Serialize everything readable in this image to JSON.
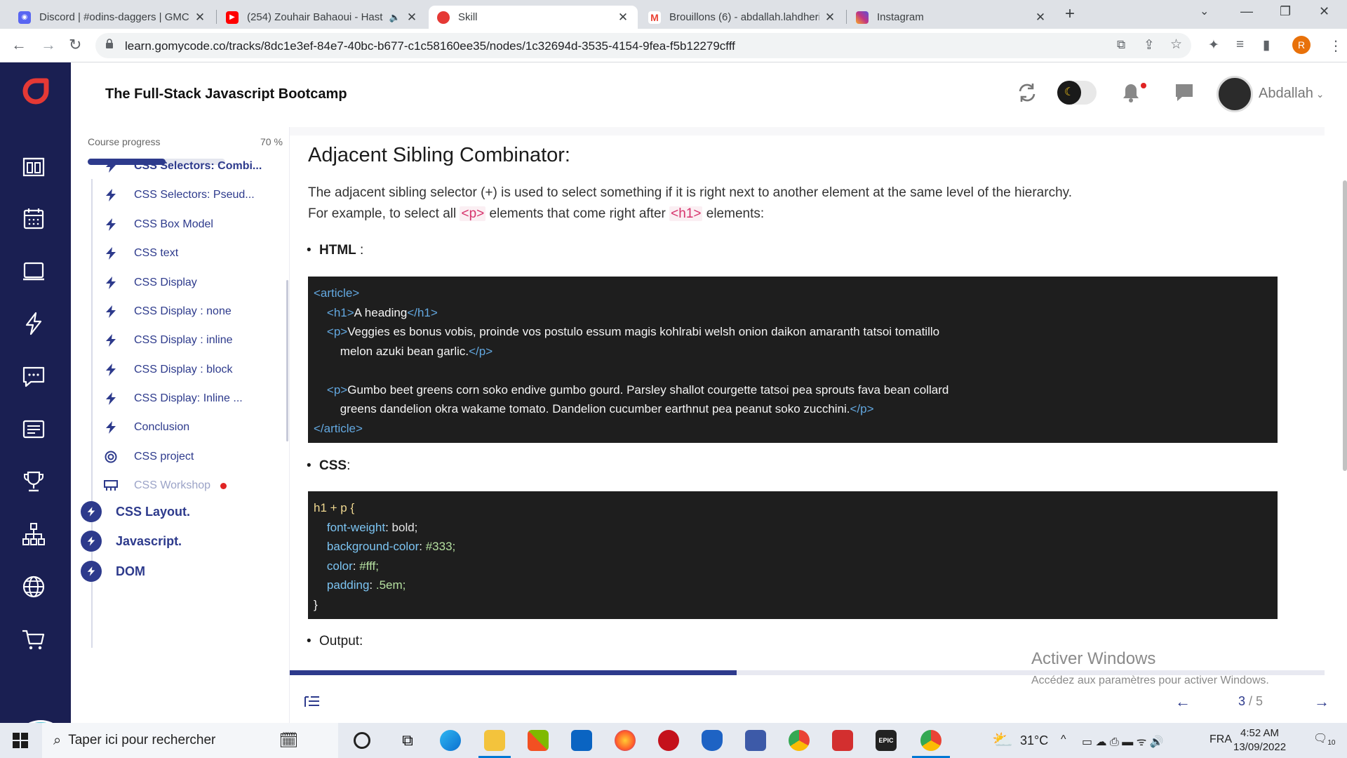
{
  "browser": {
    "tabs": [
      {
        "title": "Discord | #odins-daggers | GMC",
        "icon": "discord-icon",
        "color": "#5865f2"
      },
      {
        "title": "(254) Zouhair Bahaoui - Hast",
        "icon": "youtube-icon",
        "color": "#ff0000"
      },
      {
        "title": "Skill",
        "icon": "gomycode-icon",
        "color": "#e53935"
      },
      {
        "title": "Brouillons (6) - abdallah.lahdheri",
        "icon": "gmail-icon",
        "color": "#ea4335"
      },
      {
        "title": "Instagram",
        "icon": "instagram-icon",
        "color": "#c13584"
      }
    ],
    "url": "learn.gomycode.co/tracks/8dc1e3ef-84e7-40bc-b677-c1c58160ee35/nodes/1c32694d-3535-4154-9fea-f5b12279cfff",
    "profile_initial": "R"
  },
  "header": {
    "course_title": "The Full-Stack Javascript Bootcamp",
    "user_name": "Abdallah"
  },
  "sidebar": {
    "progress_label": "Course progress",
    "progress_value": "70 %",
    "progress_fraction": 0.7,
    "items": [
      {
        "label": "CSS Selectors: Combi...",
        "icon": "bolt-icon",
        "state": "active"
      },
      {
        "label": "CSS Selectors: Pseud...",
        "icon": "bolt-icon",
        "state": "normal"
      },
      {
        "label": "CSS Box Model",
        "icon": "bolt-icon",
        "state": "normal"
      },
      {
        "label": "CSS text",
        "icon": "bolt-icon",
        "state": "normal"
      },
      {
        "label": "CSS Display",
        "icon": "bolt-icon",
        "state": "normal"
      },
      {
        "label": "CSS Display : none",
        "icon": "bolt-icon",
        "state": "normal"
      },
      {
        "label": "CSS Display : inline",
        "icon": "bolt-icon",
        "state": "normal"
      },
      {
        "label": "CSS Display : block",
        "icon": "bolt-icon",
        "state": "normal"
      },
      {
        "label": "CSS Display: Inline ...",
        "icon": "bolt-icon",
        "state": "normal"
      },
      {
        "label": "Conclusion",
        "icon": "bolt-icon",
        "state": "normal"
      },
      {
        "label": "CSS project",
        "icon": "target-icon",
        "state": "normal"
      },
      {
        "label": "CSS Workshop",
        "icon": "workshop-icon",
        "state": "muted"
      }
    ],
    "chapters": [
      {
        "label": "CSS Layout."
      },
      {
        "label": "Javascript."
      },
      {
        "label": "DOM"
      }
    ]
  },
  "lesson": {
    "title": "Adjacent Sibling Combinator:",
    "para1": "The adjacent sibling selector (+) is used to select something if it is right next to another element at the same level of the hierarchy.",
    "para2_a": "For example, to select all ",
    "para2_tag1": "<p>",
    "para2_b": " elements that come right after ",
    "para2_tag2": "<h1>",
    "para2_c": " elements:",
    "bullet_html_label": "HTML",
    "bullet_html_suffix": " :",
    "bullet_css_label": "CSS",
    "bullet_css_suffix": ":",
    "bullet_output": "Output:",
    "html_code": {
      "article_open": "<article>",
      "h1_open": "<h1>",
      "h1_text": "A heading",
      "h1_close": "</h1>",
      "p_open": "<p>",
      "p1_text_line1": "Veggies es bonus vobis, proinde vos postulo essum magis kohlrabi welsh onion daikon amaranth tatsoi tomatillo",
      "p1_text_line2": "melon azuki bean garlic.",
      "p_close": "</p>",
      "p2_text_line1": "Gumbo beet greens corn soko endive gumbo gourd. Parsley shallot courgette tatsoi pea sprouts fava bean collard",
      "p2_text_line2": "greens dandelion okra wakame tomato. Dandelion cucumber earthnut pea peanut soko zucchini.",
      "article_close": "</article>"
    },
    "css_code": {
      "selector": "h1 + p {",
      "rules": [
        {
          "prop": "font-weight",
          "value": "bold;"
        },
        {
          "prop": "background-color",
          "value": "#333;"
        },
        {
          "prop": "color",
          "value": "#fff;"
        },
        {
          "prop": "padding",
          "value": ".5em;"
        }
      ],
      "close": "}"
    }
  },
  "pager": {
    "current": "3",
    "separator": " / ",
    "total": "5",
    "lesson_progress_fraction": 0.6
  },
  "windows": {
    "activate_title": "Activer Windows",
    "activate_sub": "Accédez aux paramètres pour activer Windows."
  },
  "taskbar": {
    "search_placeholder": "Taper ici pour rechercher",
    "weather": "31°C",
    "language": "FRA",
    "time": "4:52 AM",
    "date": "13/09/2022",
    "notifications": "10"
  },
  "colors": {
    "brand_navy": "#1a1f52",
    "accent": "#2d3a8c",
    "brand_red": "#e53935",
    "code_bg": "#1e1e1e"
  }
}
